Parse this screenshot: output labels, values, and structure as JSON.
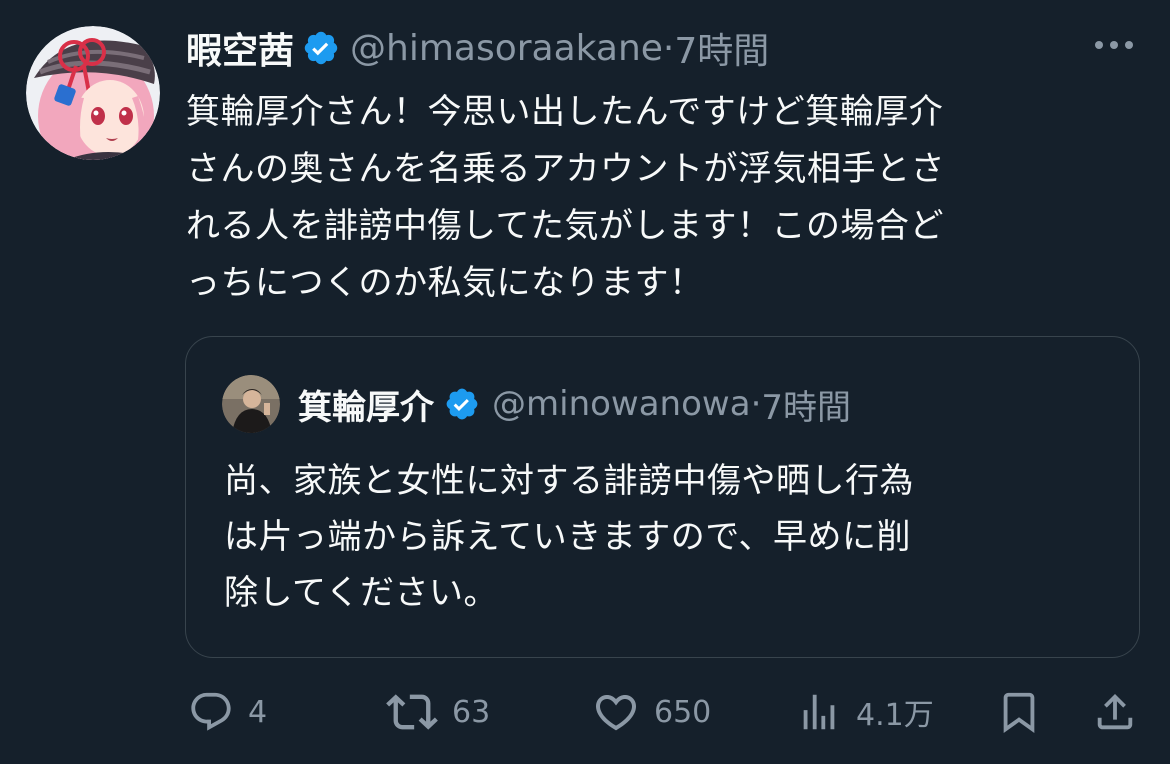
{
  "tweet": {
    "author_name": "暇空茜",
    "handle": "@himasoraakane",
    "separator": "·",
    "time": "7時間",
    "text": "箕輪厚介さん！今思い出したんですけど箕輪厚介\nさんの奥さんを名乗るアカウントが浮気相手とさ\nれる人を誹謗中傷してた気がします！この場合ど\nっちにつくのか私気になります！"
  },
  "quote": {
    "author_name": "箕輪厚介",
    "handle": "@minowanowa",
    "separator": "·",
    "time": "7時間",
    "text": "尚、家族と女性に対する誹謗中傷や晒し行為\nは片っ端から訴えていきますので、早めに削\n除してください。"
  },
  "actions": {
    "replies": "4",
    "retweets": "63",
    "likes": "650",
    "views": "4.1万"
  },
  "icons": {
    "verified": "verified-badge-icon",
    "more": "more-icon",
    "reply": "reply-icon",
    "retweet": "retweet-icon",
    "like": "heart-icon",
    "views": "views-icon",
    "bookmark": "bookmark-icon",
    "share": "share-icon"
  },
  "colors": {
    "background": "#15202b",
    "text": "#f7f9f9",
    "secondary": "#8b98a5",
    "verified": "#1d9bf0",
    "border": "#38444d"
  }
}
